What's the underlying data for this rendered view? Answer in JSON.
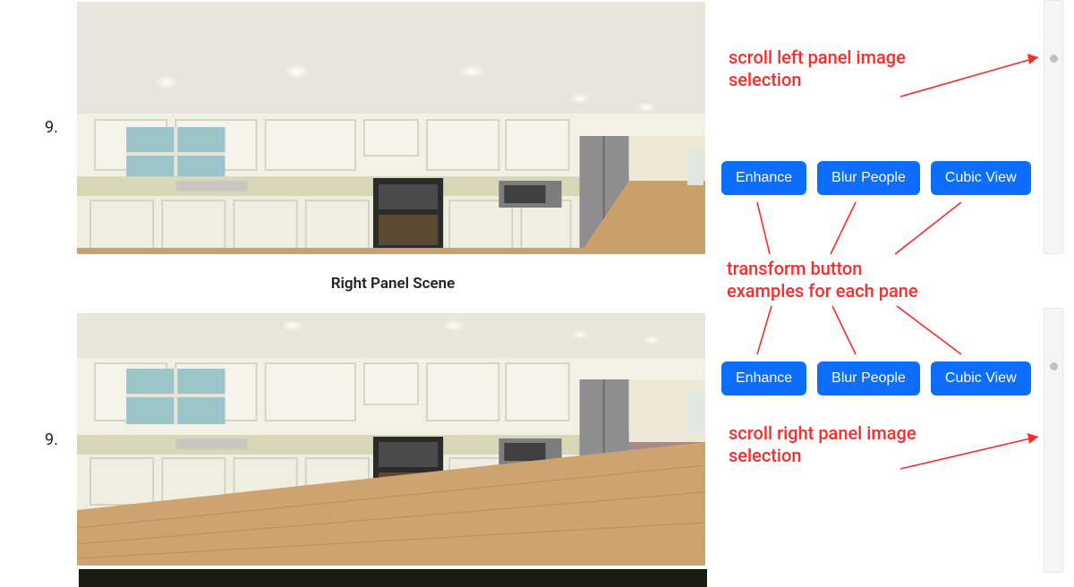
{
  "rows": {
    "top": {
      "index_label": "9."
    },
    "bottom": {
      "index_label": "9."
    }
  },
  "divider_label": "Right Panel Scene",
  "buttons": {
    "enhance": "Enhance",
    "blur": "Blur People",
    "cubic": "Cubic View"
  },
  "annotations": {
    "scroll_left": "scroll left panel image\nselection",
    "transform": "transform button\nexamples for each pane",
    "scroll_right": "scroll right panel image\nselection"
  }
}
